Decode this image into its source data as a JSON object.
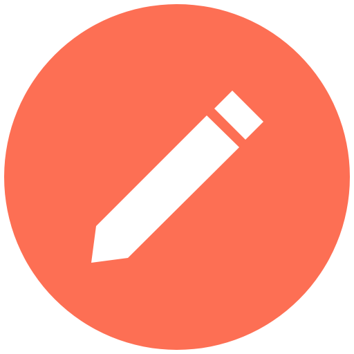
{
  "icon": {
    "name": "pencil-edit-icon",
    "background_color": "#FD6F54",
    "glyph_color": "#FFFFFF",
    "shape": "circle"
  }
}
